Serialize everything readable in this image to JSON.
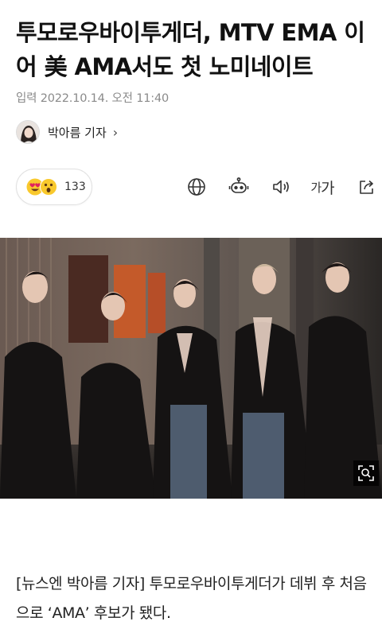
{
  "article": {
    "title": "투모로우바이투게더, MTV EMA 이어 美 AMA서도 첫 노미네이트",
    "meta": "입력 2022.10.14. 오전 11:40",
    "author": {
      "name": "박아름 기자",
      "chevron": "›"
    },
    "reactions": {
      "count": "133",
      "emojis": [
        "heart-eyes",
        "surprised"
      ]
    },
    "toolbar": {
      "font_small": "가",
      "font_big": "가",
      "icons": [
        "globe-icon",
        "robot-summary-icon",
        "speaker-icon",
        "font-size-icon",
        "share-icon"
      ]
    },
    "photo": {
      "zoom_icon": "zoom-search-icon"
    },
    "lead": "[뉴스엔 박아름 기자] 투모로우바이투게더가 데뷔 후 처음으로 ‘AMA’ 후보가 됐다."
  }
}
